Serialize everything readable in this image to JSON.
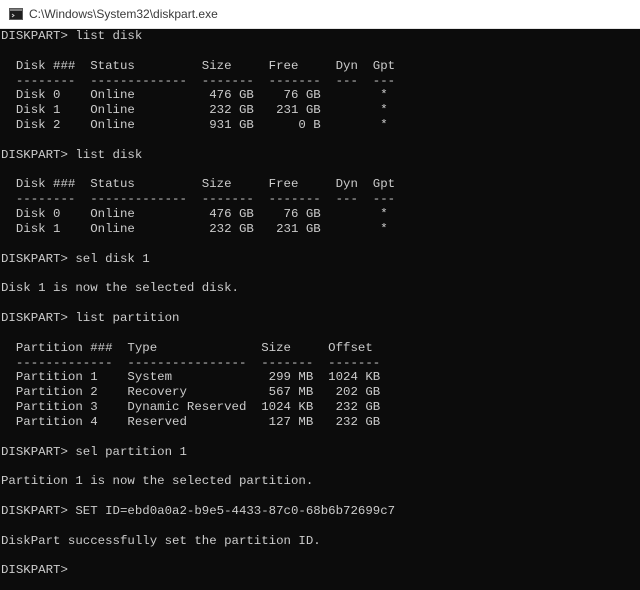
{
  "window": {
    "title": "C:\\Windows\\System32\\diskpart.exe"
  },
  "console": {
    "lines": [
      "DISKPART> list disk",
      "",
      "  Disk ###  Status         Size     Free     Dyn  Gpt",
      "  --------  -------------  -------  -------  ---  ---",
      "  Disk 0    Online          476 GB    76 GB        *",
      "  Disk 1    Online          232 GB   231 GB        *",
      "  Disk 2    Online          931 GB      0 B        *",
      "",
      "DISKPART> list disk",
      "",
      "  Disk ###  Status         Size     Free     Dyn  Gpt",
      "  --------  -------------  -------  -------  ---  ---",
      "  Disk 0    Online          476 GB    76 GB        *",
      "  Disk 1    Online          232 GB   231 GB        *",
      "",
      "DISKPART> sel disk 1",
      "",
      "Disk 1 is now the selected disk.",
      "",
      "DISKPART> list partition",
      "",
      "  Partition ###  Type              Size     Offset",
      "  -------------  ----------------  -------  -------",
      "  Partition 1    System             299 MB  1024 KB",
      "  Partition 2    Recovery           567 MB   202 GB",
      "  Partition 3    Dynamic Reserved  1024 KB   232 GB",
      "  Partition 4    Reserved           127 MB   232 GB",
      "",
      "DISKPART> sel partition 1",
      "",
      "Partition 1 is now the selected partition.",
      "",
      "DISKPART> SET ID=ebd0a0a2-b9e5-4433-87c0-68b6b72699c7",
      "",
      "DiskPart successfully set the partition ID.",
      "",
      "DISKPART> "
    ]
  },
  "colors": {
    "console_background": "#0c0c0c",
    "console_text": "#cccccc",
    "titlebar_background": "#ffffff"
  },
  "icons": {
    "app": "console-window-icon"
  }
}
